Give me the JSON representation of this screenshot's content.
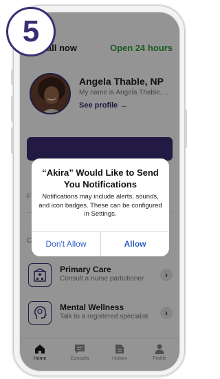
{
  "step": {
    "number": "5"
  },
  "header": {
    "left": "On call now",
    "right": "Open 24 hours"
  },
  "provider": {
    "name": "Angela Thable, NP",
    "intro": "My name is Angela Thable, I...",
    "profile_link": "See profile →"
  },
  "partial_labels": {
    "f": "F",
    "c": "C"
  },
  "services": [
    {
      "title": "Primary Care",
      "subtitle": "Consult a nurse partictioner",
      "icon": "hospital-icon",
      "chevron": "›"
    },
    {
      "title": "Mental Wellness",
      "subtitle": "Talk to a registered specialist",
      "icon": "head-brain-icon",
      "chevron": "›"
    }
  ],
  "tabs": [
    {
      "label": "Home",
      "icon": "home-icon",
      "active": true
    },
    {
      "label": "Consults",
      "icon": "chat-icon",
      "active": false
    },
    {
      "label": "History",
      "icon": "document-icon",
      "active": false
    },
    {
      "label": "Profile",
      "icon": "person-icon",
      "active": false
    }
  ],
  "alert": {
    "title": "“Akira” Would Like to Send You Notifications",
    "message": "Notifications may include alerts, sounds, and icon badges. These can be configured in Settings.",
    "deny_label": "Don't Allow",
    "allow_label": "Allow"
  },
  "colors": {
    "brand_purple": "#3b2d74",
    "open_green": "#2e9d3b",
    "alert_link_blue": "#2f5fc2"
  }
}
